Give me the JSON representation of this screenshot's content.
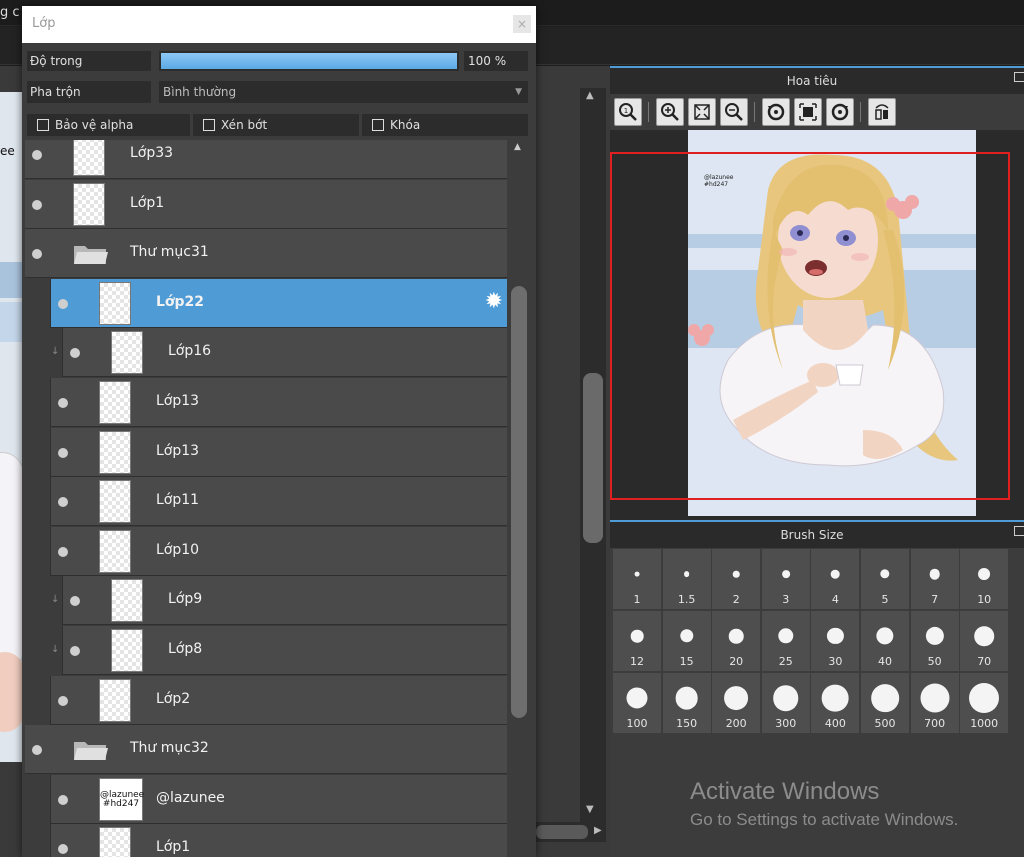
{
  "app": {
    "menu_fragment": "g c"
  },
  "canvas": {
    "edge_text": "ee"
  },
  "layer_panel": {
    "title": "Lớp",
    "close": "×",
    "opacity_label": "Độ trong",
    "opacity_value": "100 %",
    "opacity_fraction": 1.0,
    "blend_label": "Pha trộn",
    "blend_value": "Bình thường",
    "checkboxes": [
      {
        "label": "Bảo vệ alpha",
        "checked": false
      },
      {
        "label": "Xén bớt",
        "checked": false
      },
      {
        "label": "Khóa",
        "checked": false
      }
    ],
    "layers": [
      {
        "name": "Lớp33",
        "level": 0,
        "type": "layer"
      },
      {
        "name": "Lớp1",
        "level": 0,
        "type": "layer"
      },
      {
        "name": "Thư mục31",
        "level": 0,
        "type": "folder"
      },
      {
        "name": "Lớp22",
        "level": 1,
        "type": "layer",
        "selected": true
      },
      {
        "name": "Lớp16",
        "level": 2,
        "type": "layer",
        "clipped": true
      },
      {
        "name": "Lớp13",
        "level": 1,
        "type": "layer"
      },
      {
        "name": "Lớp13",
        "level": 1,
        "type": "layer"
      },
      {
        "name": "Lớp11",
        "level": 1,
        "type": "layer"
      },
      {
        "name": "Lớp10",
        "level": 1,
        "type": "layer"
      },
      {
        "name": "Lớp9",
        "level": 2,
        "type": "layer",
        "clipped": true
      },
      {
        "name": "Lớp8",
        "level": 2,
        "type": "layer",
        "clipped": true
      },
      {
        "name": "Lớp2",
        "level": 1,
        "type": "layer"
      },
      {
        "name": "Thư mục32",
        "level": 0,
        "type": "folder"
      },
      {
        "name": "@lazunee",
        "level": 1,
        "type": "text",
        "thumb_text": "@lazunee\n#hd247"
      },
      {
        "name": "Lớp1",
        "level": 1,
        "type": "layer"
      }
    ]
  },
  "navigator": {
    "title": "Hoa tiêu",
    "tools": [
      "zoom-reset-icon",
      "zoom-in-icon",
      "fit-icon",
      "zoom-out-icon",
      "rotate-left-icon",
      "actual-size-icon",
      "rotate-right-icon",
      "flip-icon"
    ],
    "watermark": "@lazunee\n#hd247"
  },
  "brush_size": {
    "title": "Brush Size",
    "sizes": [
      "1",
      "1.5",
      "2",
      "3",
      "4",
      "5",
      "7",
      "10",
      "12",
      "15",
      "20",
      "25",
      "30",
      "40",
      "50",
      "70",
      "100",
      "150",
      "200",
      "300",
      "400",
      "500",
      "700",
      "1000"
    ]
  },
  "activate": {
    "line1": "Activate Windows",
    "line2": "Go to Settings to activate Windows."
  },
  "colors": {
    "accent": "#4f9bd6",
    "nav_frame": "#e02020"
  }
}
